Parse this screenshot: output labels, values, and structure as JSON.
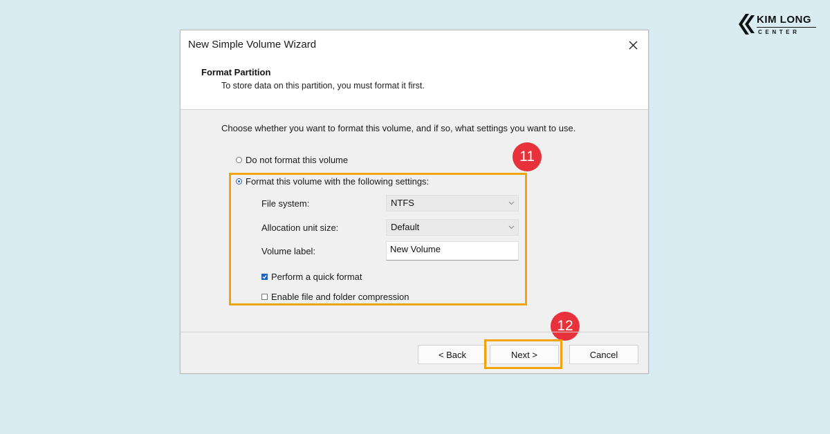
{
  "brand": {
    "name": "KIM LONG",
    "sub": "CENTER"
  },
  "dialog": {
    "title": "New Simple Volume Wizard",
    "section_title": "Format Partition",
    "section_desc": "To store data on this partition, you must format it first.",
    "instruction": "Choose whether you want to format this volume, and if so, what settings you want to use.",
    "option_no_format": "Do not format this volume",
    "option_format": "Format this volume with the following settings:",
    "file_system": {
      "label": "File system:",
      "value": "NTFS"
    },
    "allocation": {
      "label": "Allocation unit size:",
      "value": "Default"
    },
    "volume_label": {
      "label": "Volume label:",
      "value": "New Volume"
    },
    "quick_format": {
      "label": "Perform a quick format",
      "checked": true
    },
    "compression": {
      "label": "Enable file and folder compression",
      "checked": false
    },
    "buttons": {
      "back": "< Back",
      "next": "Next >",
      "cancel": "Cancel"
    }
  },
  "annotations": {
    "step_a": "11",
    "step_b": "12",
    "highlight_color": "#f0a30a",
    "badge_color": "#e8323b"
  },
  "icons": {
    "close": "close-icon",
    "dropdown": "chevron-down-icon",
    "check": "checkmark-icon"
  },
  "colors": {
    "background": "#d9ecf1",
    "accent": "#1f63c0"
  }
}
